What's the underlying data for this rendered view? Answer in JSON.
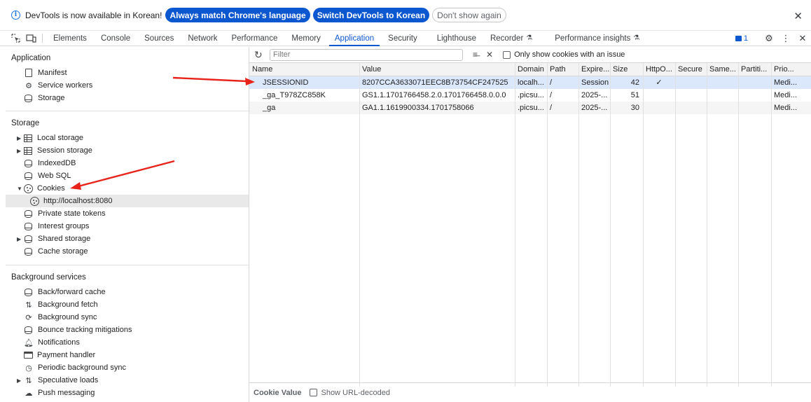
{
  "infobar": {
    "message": "DevTools is now available in Korean!",
    "btn_match": "Always match Chrome's language",
    "btn_switch": "Switch DevTools to Korean",
    "btn_dismiss": "Don't show again",
    "close": "✕"
  },
  "tabs": [
    {
      "label": "Elements"
    },
    {
      "label": "Console"
    },
    {
      "label": "Sources"
    },
    {
      "label": "Network"
    },
    {
      "label": "Performance"
    },
    {
      "label": "Memory"
    },
    {
      "label": "Application"
    },
    {
      "label": "Security"
    },
    {
      "label": "Lighthouse"
    },
    {
      "label": "Recorder"
    },
    {
      "label": "Performance insights"
    }
  ],
  "active_tab": "Application",
  "issues_count": "1",
  "sidebar": {
    "application": {
      "title": "Application",
      "items": [
        "Manifest",
        "Service workers",
        "Storage"
      ]
    },
    "storage": {
      "title": "Storage",
      "items": [
        "Local storage",
        "Session storage",
        "IndexedDB",
        "Web SQL",
        "Cookies",
        "http://localhost:8080",
        "Private state tokens",
        "Interest groups",
        "Shared storage",
        "Cache storage"
      ]
    },
    "background": {
      "title": "Background services",
      "items": [
        "Back/forward cache",
        "Background fetch",
        "Background sync",
        "Bounce tracking mitigations",
        "Notifications",
        "Payment handler",
        "Periodic background sync",
        "Speculative loads",
        "Push messaging"
      ]
    }
  },
  "toolbar": {
    "filter_placeholder": "Filter",
    "only_issue_label": "Only show cookies with an issue"
  },
  "cookies_table": {
    "columns": [
      "Name",
      "Value",
      "Domain",
      "Path",
      "Expire...",
      "Size",
      "HttpO...",
      "Secure",
      "Same...",
      "Partiti...",
      "Prio..."
    ],
    "rows": [
      [
        "JSESSIONID",
        "8207CCA3633071EEC8B73754CF247525",
        "localh...",
        "/",
        "Session",
        "42",
        "✓",
        "",
        "",
        "",
        "Medi..."
      ],
      [
        "_ga_T978ZC858K",
        "GS1.1.1701766458.2.0.1701766458.0.0.0",
        ".picsu...",
        "/",
        "2025-...",
        "51",
        "",
        "",
        "",
        "",
        "Medi..."
      ],
      [
        "_ga",
        "GA1.1.1619900334.1701758066",
        ".picsu...",
        "/",
        "2025-...",
        "30",
        "",
        "",
        "",
        "",
        "Medi..."
      ]
    ]
  },
  "footer": {
    "cookie_value_label": "Cookie Value",
    "url_decoded_label": "Show URL-decoded"
  },
  "colors": {
    "accent": "#0b57d0",
    "annotation": "#e8231a",
    "selected_row": "#dbe7fb"
  }
}
